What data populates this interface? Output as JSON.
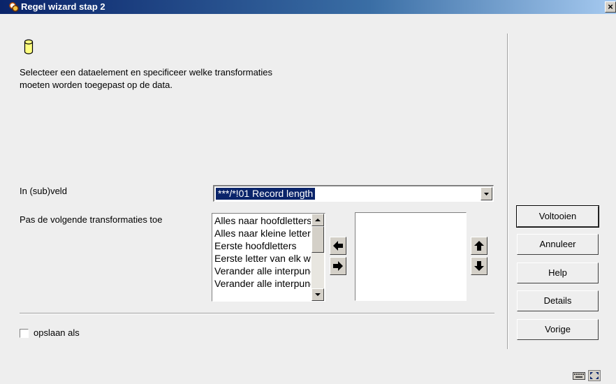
{
  "window": {
    "title": "Regel wizard stap 2",
    "close_label": "×"
  },
  "description": {
    "line1": "Selecteer een dataelement en specificeer welke transformaties",
    "line2": "moeten worden toegepast op de data."
  },
  "subfield": {
    "label": "In (sub)veld",
    "selected": "***/*!01 Record length"
  },
  "transforms": {
    "label": "Pas de volgende transformaties toe",
    "items": [
      "Alles naar hoofdletters",
      "Alles naar kleine letters",
      "Eerste hoofdletters",
      "Eerste letter van elk woord",
      "Verander alle interpunctie",
      "Verander alle interpunctie"
    ]
  },
  "buttons": {
    "finish": "Voltooien",
    "cancel": "Annuleer",
    "help": "Help",
    "details": "Details",
    "previous": "Vorige"
  },
  "save_as": {
    "label": "opslaan als",
    "checked": false
  },
  "colors": {
    "title_start": "#0a246a",
    "title_end": "#a6caf0",
    "selection": "#0a246a",
    "dialog_bg": "#eeeeee"
  }
}
